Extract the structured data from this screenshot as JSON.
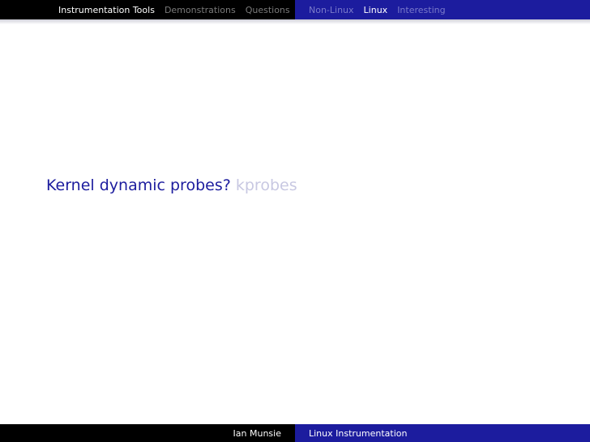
{
  "header": {
    "sections": [
      {
        "label": "Instrumentation Tools",
        "active": true
      },
      {
        "label": "Demonstrations",
        "active": false
      },
      {
        "label": "Questions",
        "active": false
      }
    ],
    "subsections": [
      {
        "label": "Non-Linux",
        "active": false
      },
      {
        "label": "Linux",
        "active": true
      },
      {
        "label": "Interesting",
        "active": false
      }
    ]
  },
  "slide": {
    "title": "Kernel dynamic probes?",
    "subtitle": "kprobes"
  },
  "footer": {
    "author": "Ian Munsie",
    "talk_title": "Linux Instrumentation"
  },
  "colors": {
    "beamer_blue": "#1c1c9e",
    "bar_black": "#000000",
    "inactive_gray": "#7a7a7a",
    "inactive_blue": "#7a7aca",
    "subtitle_faded": "#c8c8e2"
  }
}
